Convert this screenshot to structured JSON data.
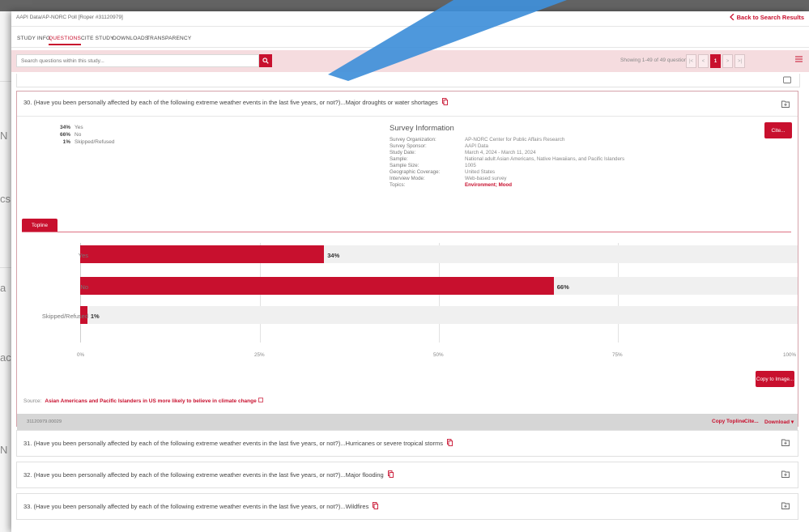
{
  "colors": {
    "accent": "#c8102e",
    "highlight_band": "#f5dcdf",
    "arrow": "#3f8fd9"
  },
  "background_fragments": [
    "N",
    "cs",
    "a",
    "ac",
    "N"
  ],
  "header": {
    "breadcrumb": "AAPI Data/AP-NORC Poll [Roper #31120979]",
    "back_label": "Back to Search Results"
  },
  "tabs": [
    {
      "label": "STUDY INFO"
    },
    {
      "label": "QUESTIONS",
      "active": true
    },
    {
      "label": "CITE STUDY"
    },
    {
      "label": "DOWNLOADS"
    },
    {
      "label": "TRANSPARENCY"
    }
  ],
  "search": {
    "placeholder": "Search questions within this study...",
    "showing": "Showing 1-49 of 49 questions",
    "current_page": "1",
    "pager_icons": [
      "first-page-icon",
      "prev-page-icon",
      "next-page-icon",
      "last-page-icon"
    ]
  },
  "question": {
    "title": "30. (Have you been personally affected by each of the following extreme weather events in the last five years, or not?)...Major droughts or water shortages",
    "responses": [
      {
        "pct": "34%",
        "label": "Yes"
      },
      {
        "pct": "66%",
        "label": "No"
      },
      {
        "pct": "1%",
        "label": "Skipped/Refused"
      }
    ],
    "survey": {
      "title": "Survey Information",
      "rows": [
        {
          "k": "Survey Organization:",
          "v": "AP-NORC Center for Public Affairs Research"
        },
        {
          "k": "Survey Sponsor:",
          "v": "AAPI Data"
        },
        {
          "k": "Study Date:",
          "v": "March 4, 2024 - March 11, 2024"
        },
        {
          "k": "Sample:",
          "v": "National adult Asian Americans, Native Hawaiians, and Pacific Islanders"
        },
        {
          "k": "Sample Size:",
          "v": "1005"
        },
        {
          "k": "Geographic Coverage:",
          "v": "United States"
        },
        {
          "k": "Interview Mode:",
          "v": "Web-based survey"
        },
        {
          "k": "Topics:",
          "v": "Environment; Mood",
          "red": true
        }
      ]
    },
    "cite_label": "Cite...",
    "topline_label": "Topline",
    "copy_image_label": "Copy to Image...",
    "source_label": "Source:",
    "source_link": "Asian Americans and Pacific Islanders in US more likely to believe in climate change",
    "question_id": "31120979.00029",
    "footer_links": [
      "Copy Topline",
      "Cite...",
      "Download"
    ]
  },
  "chart_data": {
    "type": "bar",
    "orientation": "horizontal",
    "categories": [
      "Yes",
      "No",
      "Skipped/Refused"
    ],
    "values": [
      34,
      66,
      1
    ],
    "value_labels": [
      "34%",
      "66%",
      "1%"
    ],
    "xlim": [
      0,
      100
    ],
    "ticks": [
      "0%",
      "25%",
      "50%",
      "75%",
      "100%"
    ],
    "title": "",
    "xlabel": "",
    "ylabel": ""
  },
  "other_questions": [
    {
      "title": "31. (Have you been personally affected by each of the following extreme weather events in the last five years, or not?)...Hurricanes or severe tropical storms"
    },
    {
      "title": "32. (Have you been personally affected by each of the following extreme weather events in the last five years, or not?)...Major flooding"
    },
    {
      "title": "33. (Have you been personally affected by each of the following extreme weather events in the last five years, or not?)...Wildfires"
    }
  ]
}
